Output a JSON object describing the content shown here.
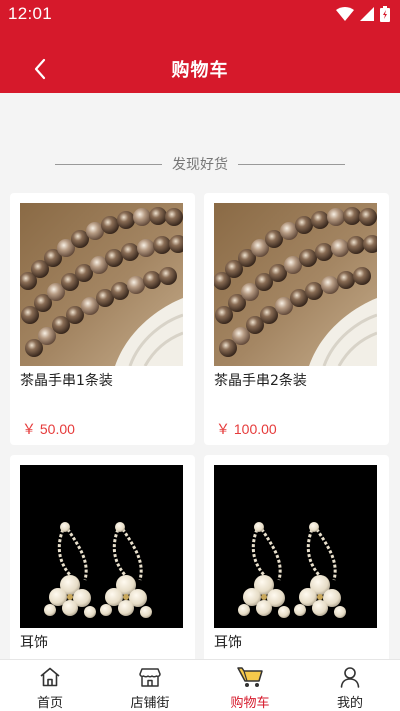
{
  "status_bar": {
    "time": "12:01"
  },
  "header": {
    "title": "购物车"
  },
  "section": {
    "label": "发现好货"
  },
  "products": [
    {
      "name": "茶晶手串1条装",
      "price": "￥ 50.00",
      "image": "smoky-quartz-bracelet"
    },
    {
      "name": "茶晶手串2条装",
      "price": "￥ 100.00",
      "image": "smoky-quartz-bracelet"
    },
    {
      "name": "耳饰",
      "price": "",
      "image": "flower-earrings"
    },
    {
      "name": "耳饰",
      "price": "",
      "image": "flower-earrings"
    }
  ],
  "bottom_nav": [
    {
      "label": "首页",
      "icon": "home-icon"
    },
    {
      "label": "店铺街",
      "icon": "store-icon"
    },
    {
      "label": "购物车",
      "icon": "cart-icon",
      "active": true
    },
    {
      "label": "我的",
      "icon": "user-icon"
    }
  ],
  "colors": {
    "brand": "#d6192b",
    "price": "#e63b3b",
    "background": "#f4f4f4"
  }
}
